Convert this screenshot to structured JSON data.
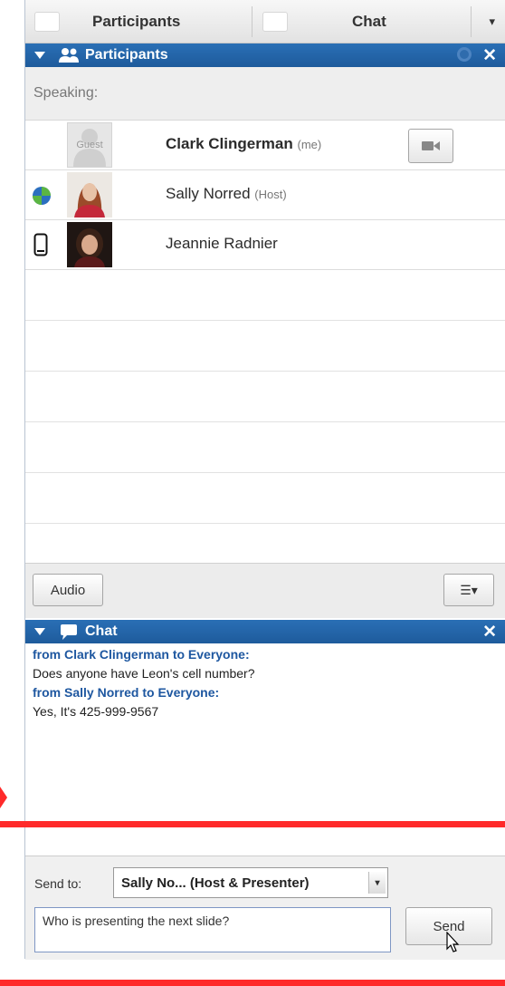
{
  "tabs": {
    "participants_label": "Participants",
    "chat_label": "Chat",
    "dropdown_icon": "▾"
  },
  "participants_panel": {
    "title": "Participants",
    "close_icon": "✕",
    "speaking_label": "Speaking:",
    "people": [
      {
        "name": "Clark Clingerman",
        "role": "(me)",
        "bold": true,
        "avatar_text": "Guest",
        "status_icon": "",
        "has_video_button": true
      },
      {
        "name": "Sally Norred",
        "role": "(Host)",
        "bold": false,
        "avatar_text": "",
        "status_icon": "globe-icon",
        "has_video_button": false
      },
      {
        "name": "Jeannie Radnier",
        "role": "",
        "bold": false,
        "avatar_text": "",
        "status_icon": "phone-icon",
        "has_video_button": false
      }
    ],
    "audio_button": "Audio",
    "list_options_icon": "☰▾"
  },
  "chat_panel": {
    "title": "Chat",
    "close_icon": "✕",
    "messages": [
      {
        "from": "from Clark Clingerman to Everyone:",
        "text": "Does anyone have Leon's cell number?"
      },
      {
        "from": "from Sally Norred to Everyone:",
        "text": "Yes, It's 425-999-9567"
      }
    ],
    "send_to_label": "Send to:",
    "send_to_value": "Sally No... (Host & Presenter)",
    "send_to_arrow": "▾",
    "input_value": "Who is presenting the next slide?",
    "send_button": "Send"
  },
  "colors": {
    "header_blue": "#1e5b9c",
    "from_text": "#1e57a0",
    "annotation_red": "#ff2a2a"
  }
}
